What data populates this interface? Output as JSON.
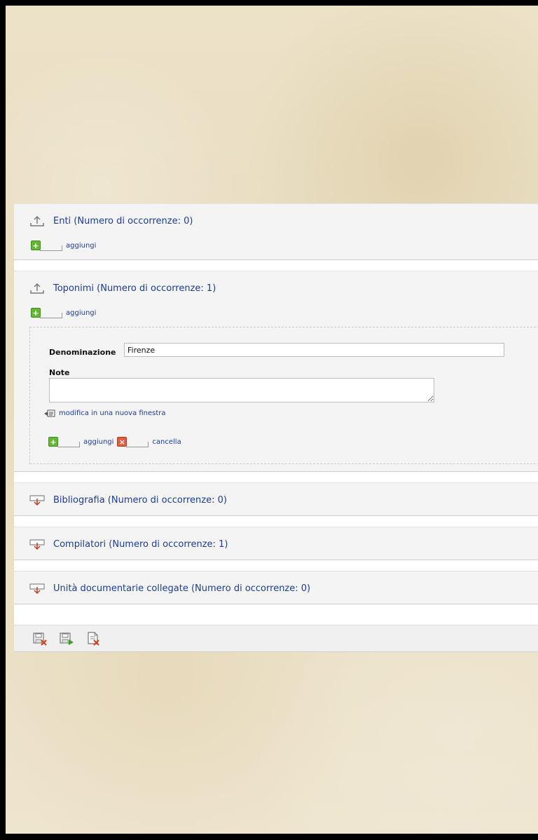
{
  "sections": {
    "enti": {
      "title": "Enti (Numero di occorrenze: 0)",
      "add_label": "aggiungi"
    },
    "toponimi": {
      "title": "Toponimi (Numero di occorrenze: 1)",
      "add_label": "aggiungi",
      "entry": {
        "denominazione_label": "Denominazione",
        "denominazione_value": "Firenze",
        "note_label": "Note",
        "edit_link": "modifica in una nuova finestra",
        "add_label": "aggiungi",
        "delete_label": "cancella"
      }
    },
    "bibliografia": {
      "title": "Bibliografia (Numero di occorrenze: 0)"
    },
    "compilatori": {
      "title": "Compilatori (Numero di occorrenze: 1)"
    },
    "unita": {
      "title": "Unità documentarie collegate (Numero di occorrenze: 0)"
    }
  },
  "icons": {
    "collapse": "upload-arrow-icon",
    "expand": "download-arrow-icon",
    "add": "plus-icon",
    "delete": "close-icon",
    "toolbar": [
      "save-close-icon",
      "save-continue-icon",
      "cancel-document-icon"
    ]
  },
  "colors": {
    "link": "#1c3c93",
    "add_green": "#65b833",
    "delete_red": "#e35c3d",
    "section_bg": "#f4f4f4"
  }
}
